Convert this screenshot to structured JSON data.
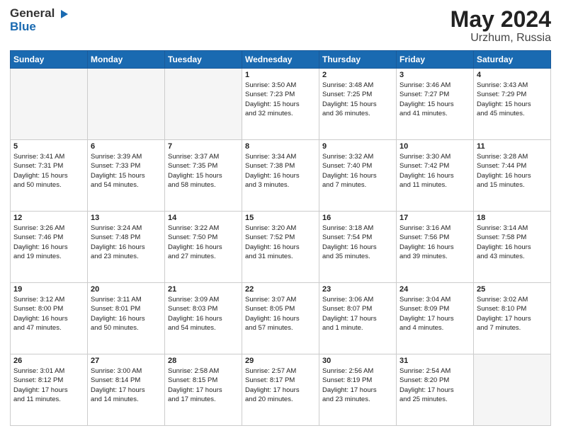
{
  "header": {
    "logo_line1": "General",
    "logo_line2": "Blue",
    "title": "May 2024",
    "subtitle": "Urzhum, Russia"
  },
  "columns": [
    "Sunday",
    "Monday",
    "Tuesday",
    "Wednesday",
    "Thursday",
    "Friday",
    "Saturday"
  ],
  "weeks": [
    [
      {
        "day": "",
        "info": ""
      },
      {
        "day": "",
        "info": ""
      },
      {
        "day": "",
        "info": ""
      },
      {
        "day": "1",
        "info": "Sunrise: 3:50 AM\nSunset: 7:23 PM\nDaylight: 15 hours\nand 32 minutes."
      },
      {
        "day": "2",
        "info": "Sunrise: 3:48 AM\nSunset: 7:25 PM\nDaylight: 15 hours\nand 36 minutes."
      },
      {
        "day": "3",
        "info": "Sunrise: 3:46 AM\nSunset: 7:27 PM\nDaylight: 15 hours\nand 41 minutes."
      },
      {
        "day": "4",
        "info": "Sunrise: 3:43 AM\nSunset: 7:29 PM\nDaylight: 15 hours\nand 45 minutes."
      }
    ],
    [
      {
        "day": "5",
        "info": "Sunrise: 3:41 AM\nSunset: 7:31 PM\nDaylight: 15 hours\nand 50 minutes."
      },
      {
        "day": "6",
        "info": "Sunrise: 3:39 AM\nSunset: 7:33 PM\nDaylight: 15 hours\nand 54 minutes."
      },
      {
        "day": "7",
        "info": "Sunrise: 3:37 AM\nSunset: 7:35 PM\nDaylight: 15 hours\nand 58 minutes."
      },
      {
        "day": "8",
        "info": "Sunrise: 3:34 AM\nSunset: 7:38 PM\nDaylight: 16 hours\nand 3 minutes."
      },
      {
        "day": "9",
        "info": "Sunrise: 3:32 AM\nSunset: 7:40 PM\nDaylight: 16 hours\nand 7 minutes."
      },
      {
        "day": "10",
        "info": "Sunrise: 3:30 AM\nSunset: 7:42 PM\nDaylight: 16 hours\nand 11 minutes."
      },
      {
        "day": "11",
        "info": "Sunrise: 3:28 AM\nSunset: 7:44 PM\nDaylight: 16 hours\nand 15 minutes."
      }
    ],
    [
      {
        "day": "12",
        "info": "Sunrise: 3:26 AM\nSunset: 7:46 PM\nDaylight: 16 hours\nand 19 minutes."
      },
      {
        "day": "13",
        "info": "Sunrise: 3:24 AM\nSunset: 7:48 PM\nDaylight: 16 hours\nand 23 minutes."
      },
      {
        "day": "14",
        "info": "Sunrise: 3:22 AM\nSunset: 7:50 PM\nDaylight: 16 hours\nand 27 minutes."
      },
      {
        "day": "15",
        "info": "Sunrise: 3:20 AM\nSunset: 7:52 PM\nDaylight: 16 hours\nand 31 minutes."
      },
      {
        "day": "16",
        "info": "Sunrise: 3:18 AM\nSunset: 7:54 PM\nDaylight: 16 hours\nand 35 minutes."
      },
      {
        "day": "17",
        "info": "Sunrise: 3:16 AM\nSunset: 7:56 PM\nDaylight: 16 hours\nand 39 minutes."
      },
      {
        "day": "18",
        "info": "Sunrise: 3:14 AM\nSunset: 7:58 PM\nDaylight: 16 hours\nand 43 minutes."
      }
    ],
    [
      {
        "day": "19",
        "info": "Sunrise: 3:12 AM\nSunset: 8:00 PM\nDaylight: 16 hours\nand 47 minutes."
      },
      {
        "day": "20",
        "info": "Sunrise: 3:11 AM\nSunset: 8:01 PM\nDaylight: 16 hours\nand 50 minutes."
      },
      {
        "day": "21",
        "info": "Sunrise: 3:09 AM\nSunset: 8:03 PM\nDaylight: 16 hours\nand 54 minutes."
      },
      {
        "day": "22",
        "info": "Sunrise: 3:07 AM\nSunset: 8:05 PM\nDaylight: 16 hours\nand 57 minutes."
      },
      {
        "day": "23",
        "info": "Sunrise: 3:06 AM\nSunset: 8:07 PM\nDaylight: 17 hours\nand 1 minute."
      },
      {
        "day": "24",
        "info": "Sunrise: 3:04 AM\nSunset: 8:09 PM\nDaylight: 17 hours\nand 4 minutes."
      },
      {
        "day": "25",
        "info": "Sunrise: 3:02 AM\nSunset: 8:10 PM\nDaylight: 17 hours\nand 7 minutes."
      }
    ],
    [
      {
        "day": "26",
        "info": "Sunrise: 3:01 AM\nSunset: 8:12 PM\nDaylight: 17 hours\nand 11 minutes."
      },
      {
        "day": "27",
        "info": "Sunrise: 3:00 AM\nSunset: 8:14 PM\nDaylight: 17 hours\nand 14 minutes."
      },
      {
        "day": "28",
        "info": "Sunrise: 2:58 AM\nSunset: 8:15 PM\nDaylight: 17 hours\nand 17 minutes."
      },
      {
        "day": "29",
        "info": "Sunrise: 2:57 AM\nSunset: 8:17 PM\nDaylight: 17 hours\nand 20 minutes."
      },
      {
        "day": "30",
        "info": "Sunrise: 2:56 AM\nSunset: 8:19 PM\nDaylight: 17 hours\nand 23 minutes."
      },
      {
        "day": "31",
        "info": "Sunrise: 2:54 AM\nSunset: 8:20 PM\nDaylight: 17 hours\nand 25 minutes."
      },
      {
        "day": "",
        "info": ""
      }
    ]
  ]
}
